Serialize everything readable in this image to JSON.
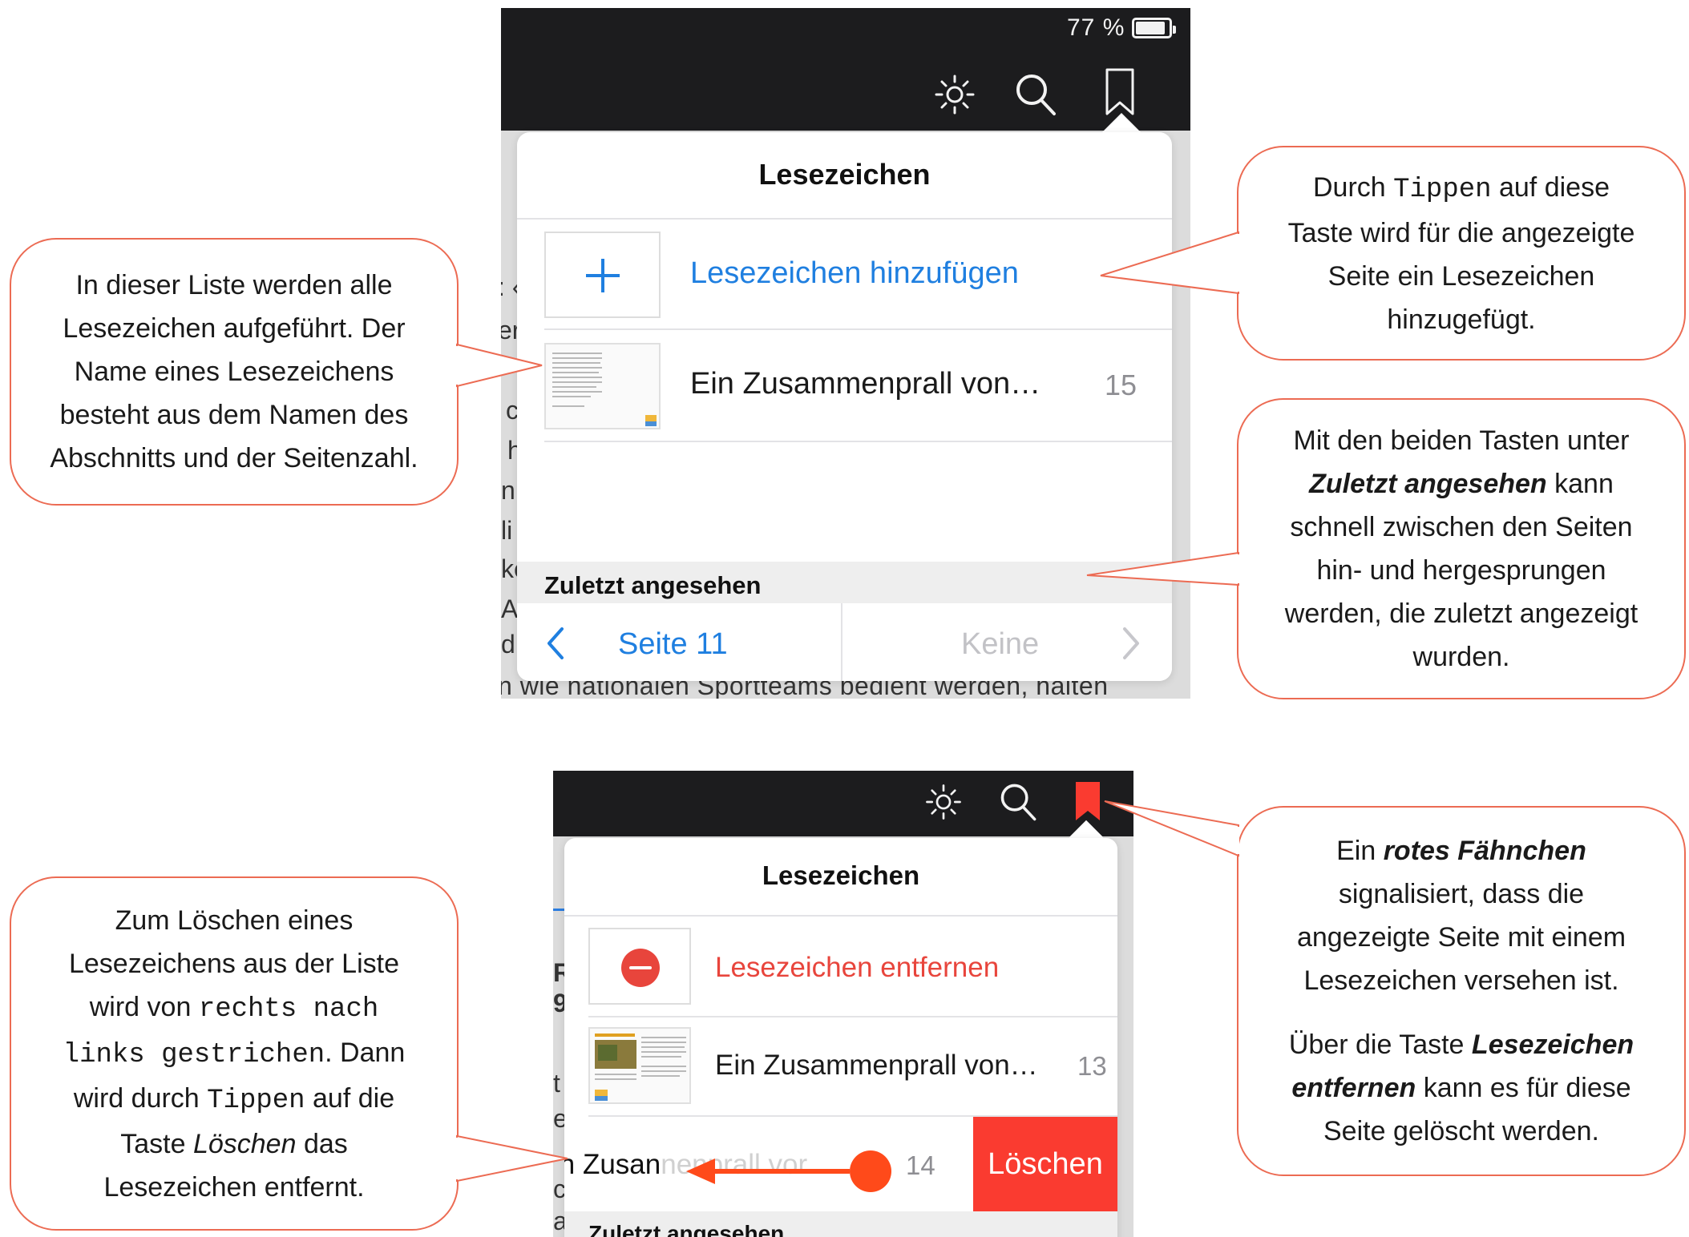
{
  "top_screen": {
    "status": {
      "battery_text": "77 %"
    },
    "toolbar": {
      "brightness_icon": "brightness-icon",
      "search_icon": "search-icon",
      "bookmark_icon": "bookmark-outline-icon"
    },
    "background_lines": [
      ": ‹",
      "er",
      "",
      "c",
      "h",
      "n",
      "li",
      "ke",
      "Ar",
      "d"
    ],
    "background_bottom_line": "n wie nationalen Sportteams bedient werden, halten",
    "popover": {
      "title": "Lesezeichen",
      "add_label": "Lesezeichen hinzufügen",
      "bookmark": {
        "title": "Ein Zusammenprall von…",
        "page": "15"
      },
      "recent_header": "Zuletzt angesehen",
      "nav": {
        "prev_label": "Seite 11",
        "next_label": "Keine"
      }
    }
  },
  "bottom_screen": {
    "toolbar": {
      "brightness_icon": "brightness-icon",
      "search_icon": "search-icon",
      "bookmark_icon": "bookmark-filled-red-icon"
    },
    "background_lines": [
      "R",
      "9",
      "",
      "t",
      "e",
      "oi",
      "ch",
      "ah"
    ],
    "popover": {
      "title": "Lesezeichen",
      "remove_label": "Lesezeichen entfernen",
      "bookmark1": {
        "title": "Ein Zusammenprall von…",
        "page": "13"
      },
      "bookmark2": {
        "title_visible": "in Zusan",
        "title_faded": "nenprall vor",
        "page": "14"
      },
      "delete_label": "Löschen",
      "recent_header": "Zuletzt angesehen"
    },
    "colors": {
      "accent_red": "#fa3b30",
      "swipe_marker": "#ff4a1a"
    }
  },
  "callouts": {
    "list_info": {
      "lines": [
        "In dieser Liste werden alle",
        "Lesezeichen aufgeführt. Der",
        "Name eines Lesezeichens",
        "besteht aus dem Namen des",
        "Abschnitts und der Seitenzahl."
      ]
    },
    "add_info": {
      "l1_pre": "Durch ",
      "l1_code": "Tippen",
      "l1_post": " auf diese",
      "l2": "Taste wird für die angezeigte",
      "l3": "Seite ein Lesezeichen",
      "l4": "hinzugefügt."
    },
    "recent_info": {
      "l1": "Mit den beiden Tasten unter",
      "l2_bi": "Zuletzt angesehen",
      "l2_post": " kann",
      "l3": "schnell zwischen den Seiten",
      "l4": "hin- und hergesprungen",
      "l5": "werden, die zuletzt angezeigt",
      "l6": "wurden."
    },
    "delete_info": {
      "l1": "Zum Löschen eines",
      "l2": "Lesezeichens aus der Liste",
      "l3_pre": "wird von ",
      "l3_code": "rechts nach",
      "l4_code": "links gestrichen",
      "l4_post": ". Dann",
      "l5_pre": "wird durch ",
      "l5_code": "Tippen",
      "l5_post": " auf die",
      "l6_pre": "Taste ",
      "l6_it": "Löschen",
      "l6_post": " das",
      "l7": "Lesezeichen entfernt."
    },
    "flag_info": {
      "l1_pre": "Ein ",
      "l1_bi": "rotes Fähnchen",
      "l2": "signalisiert, dass die",
      "l3": "angezeigte Seite mit einem",
      "l4": "Lesezeichen versehen ist.",
      "l5_pre": "Über die Taste ",
      "l5_bi": "Lesezeichen",
      "l6_bi": "entfernen",
      "l6_post": " kann es für diese",
      "l7": "Seite gelöscht werden."
    }
  },
  "colors": {
    "callout_border": "#ec6b53",
    "ios_blue": "#1f7fe0",
    "toolbar_dark": "#1c1c1e"
  }
}
